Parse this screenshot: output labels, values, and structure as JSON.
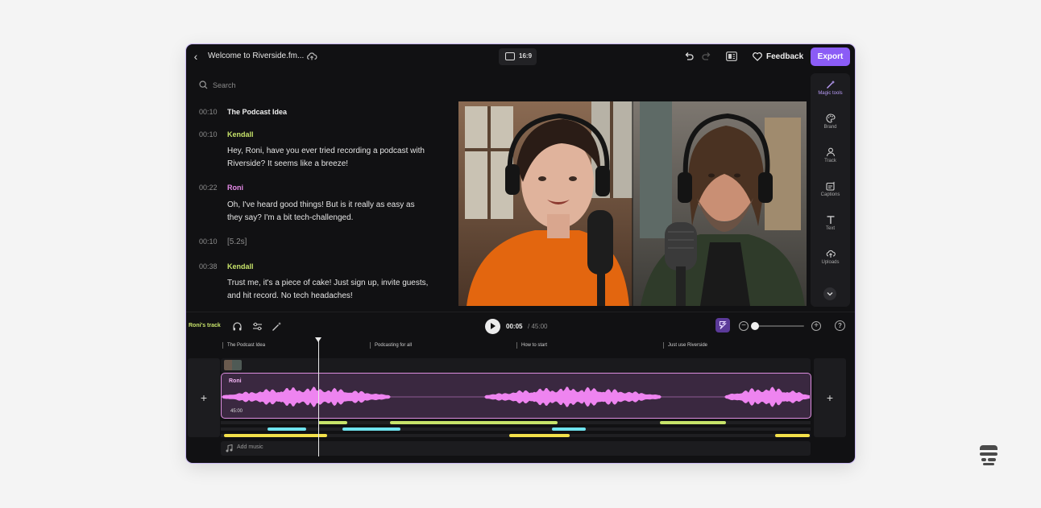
{
  "topbar": {
    "project_title": "Welcome to Riverside.fm...",
    "aspect_ratio": "16:9",
    "feedback_label": "Feedback",
    "export_label": "Export"
  },
  "transcript": {
    "search_placeholder": "Search",
    "entries": [
      {
        "time": "00:10",
        "kind": "heading",
        "text": "The Podcast Idea"
      },
      {
        "time": "00:10",
        "kind": "speaker",
        "speaker": "Kendall",
        "text": "Hey, Roni, have you ever tried recording a podcast with Riverside? It seems like a breeze!"
      },
      {
        "time": "00:22",
        "kind": "speaker",
        "speaker": "Roni",
        "text": "Oh, I've heard good things! But is it really as easy as they say? I'm a bit tech-challenged."
      },
      {
        "time": "00:10",
        "kind": "gap",
        "text": "[5.2s]"
      },
      {
        "time": "00:38",
        "kind": "speaker",
        "speaker": "Kendall",
        "text": "Trust me, it's a piece of cake! Just sign up, invite guests, and hit record. No tech headaches!"
      }
    ]
  },
  "tools": [
    {
      "label": "Magic tools",
      "icon": "magic-wand-icon",
      "active": true
    },
    {
      "label": "Brand",
      "icon": "palette-icon",
      "active": false
    },
    {
      "label": "Track",
      "icon": "person-icon",
      "active": false
    },
    {
      "label": "Captions",
      "icon": "captions-icon",
      "active": false
    },
    {
      "label": "Text",
      "icon": "text-icon",
      "active": false
    },
    {
      "label": "Uploads",
      "icon": "upload-icon",
      "active": false
    }
  ],
  "timeline": {
    "track_name": "Roni's track",
    "current_time": "00:05",
    "total_time": "/ 45:00",
    "zoom_level": 0.0,
    "chapters": [
      "The Podcast Idea",
      "Podcasting for all",
      "How to start",
      "Just use Riverside"
    ],
    "clip_name": "Roni",
    "clip_duration": "45:00",
    "music_label": "Add music"
  },
  "colors": {
    "accent": "#8b5cf6",
    "kendall": "#c7e36a",
    "roni": "#e68ae8",
    "caption_green": "#c7e36a",
    "caption_cyan": "#6fe3ef",
    "caption_yellow": "#f3e04a"
  }
}
